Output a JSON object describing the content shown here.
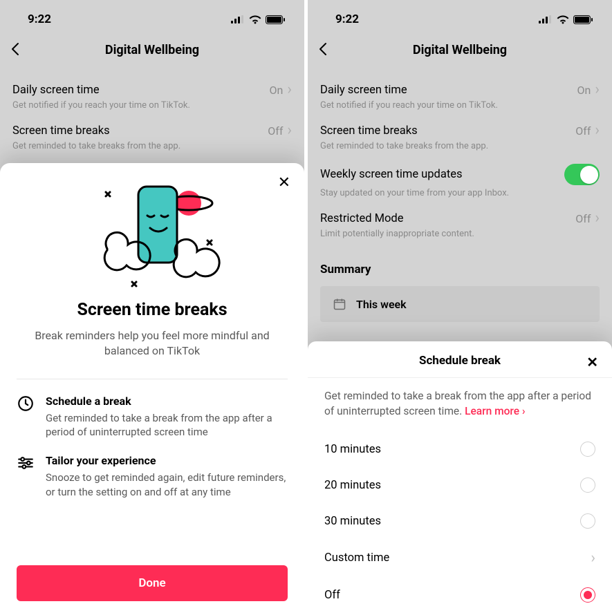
{
  "statusbar": {
    "time": "9:22"
  },
  "header": {
    "title": "Digital Wellbeing"
  },
  "rows": {
    "daily": {
      "label": "Daily screen time",
      "value": "On",
      "sub": "Get notified if you reach your time on TikTok."
    },
    "breaks": {
      "label": "Screen time breaks",
      "value": "Off",
      "sub": "Get reminded to take breaks from the app."
    },
    "weekly": {
      "label": "Weekly screen time updates",
      "sub": "Stay updated on your time from your app Inbox."
    },
    "restricted": {
      "label": "Restricted Mode",
      "value": "Off",
      "sub": "Limit potentially inappropriate content."
    }
  },
  "summary": {
    "heading": "Summary",
    "thisWeek": "This week"
  },
  "modal1": {
    "title": "Screen time breaks",
    "sub": "Break reminders help you feel more mindful and balanced on TikTok",
    "feat1": {
      "title": "Schedule a break",
      "body": "Get reminded to take a break from the app after a period of uninterrupted screen time"
    },
    "feat2": {
      "title": "Tailor your experience",
      "body": "Snooze to get reminded again, edit future reminders, or turn the setting on and off at any time"
    },
    "done": "Done"
  },
  "modal2": {
    "title": "Schedule break",
    "desc": "Get reminded to take a break from the app after a period of uninterrupted screen time. ",
    "learnMore": "Learn more",
    "options": {
      "o1": "10 minutes",
      "o2": "20 minutes",
      "o3": "30 minutes",
      "custom": "Custom time",
      "off": "Off"
    }
  }
}
